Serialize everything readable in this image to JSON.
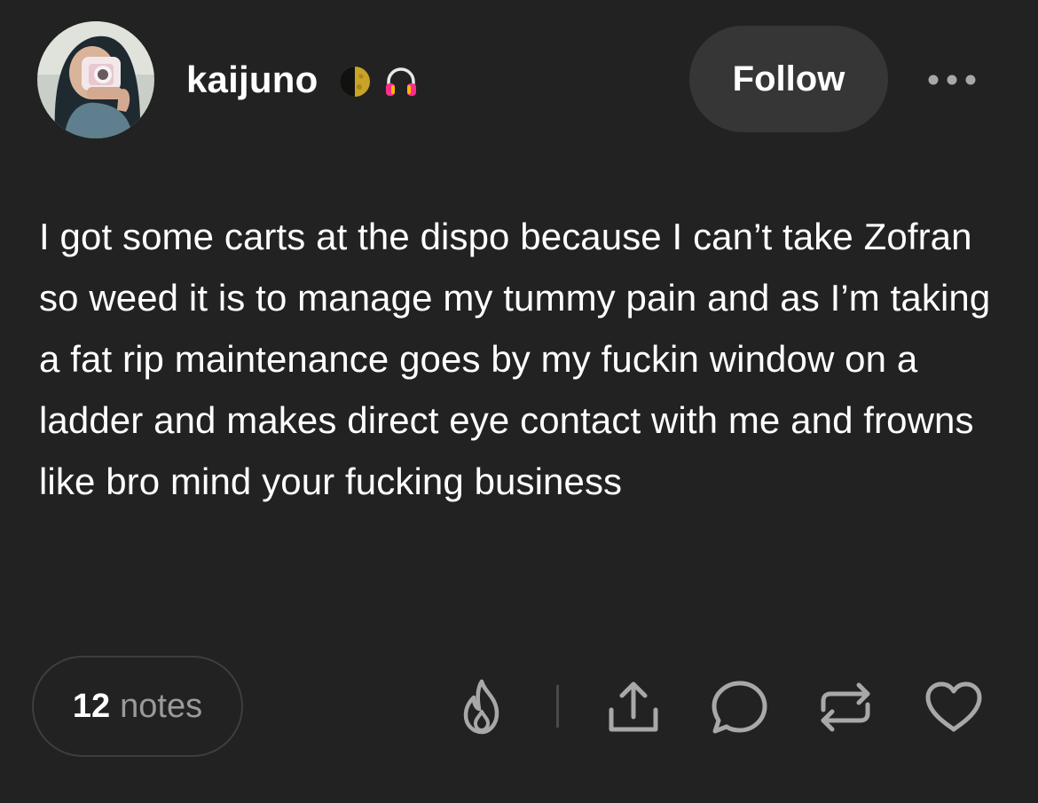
{
  "post": {
    "author": {
      "username": "kaijuno",
      "badges": [
        "moon-badge-icon",
        "headphones-badge-icon"
      ]
    },
    "follow_label": "Follow",
    "more_icon": "ellipsis-icon",
    "body": "I got some carts at the dispo because I can’t take Zofran so weed it is to manage my tummy pain and as I’m taking a fat rip maintenance goes by my fuckin window on a ladder and makes direct eye contact with me and frowns like bro mind your fucking business",
    "notes": {
      "count": "12",
      "label": "notes"
    },
    "actions": [
      "blaze-icon",
      "share-icon",
      "reply-icon",
      "reblog-icon",
      "like-icon"
    ]
  },
  "colors": {
    "background": "#222222",
    "text": "#ffffff",
    "muted": "#9a9a9a",
    "button_bg": "#363636",
    "icon": "#a8a8a8"
  }
}
